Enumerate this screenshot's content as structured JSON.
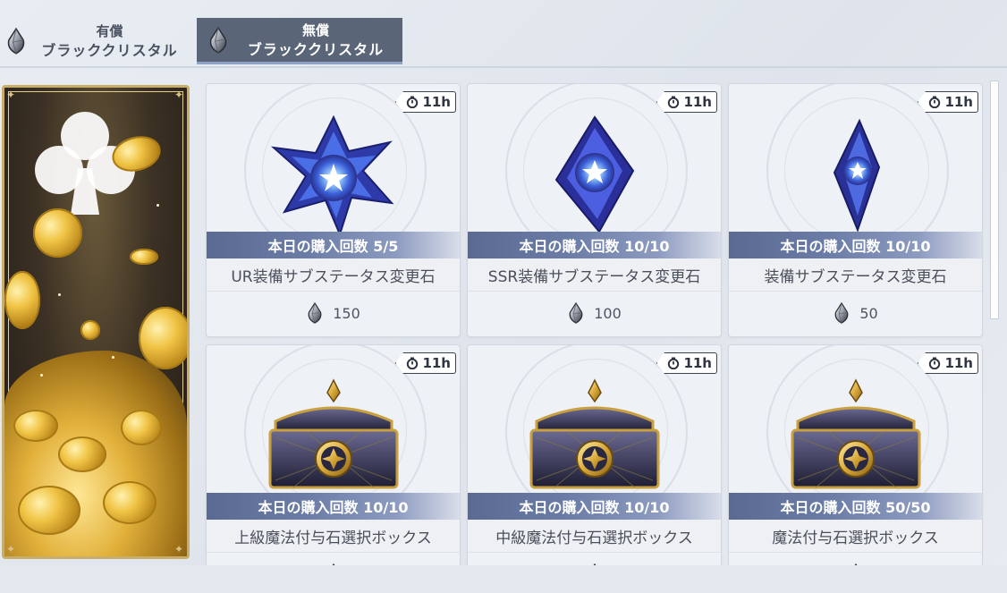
{
  "tabs": [
    {
      "line1": "有償",
      "line2": "ブラッククリスタル",
      "active": false,
      "icon": "black-crystal-icon"
    },
    {
      "line1": "無償",
      "line2": "ブラッククリスタル",
      "active": true,
      "icon": "black-crystal-icon"
    }
  ],
  "colors": {
    "active_tab": "#5a6677",
    "count_bar": "#6b7ca6",
    "banner_frame": "#c9ad6a"
  },
  "cards": [
    {
      "timer": "11h",
      "count": "本日の購入回数 5/5",
      "name": "UR装備サブステータス変更石",
      "price": "150",
      "art": "crystal-star-large"
    },
    {
      "timer": "11h",
      "count": "本日の購入回数 10/10",
      "name": "SSR装備サブステータス変更石",
      "price": "100",
      "art": "crystal-diamond"
    },
    {
      "timer": "11h",
      "count": "本日の購入回数 10/10",
      "name": "装備サブステータス変更石",
      "price": "50",
      "art": "crystal-shard"
    },
    {
      "timer": "11h",
      "count": "本日の購入回数 10/10",
      "name": "上級魔法付与石選択ボックス",
      "price": "",
      "art": "treasure-chest"
    },
    {
      "timer": "11h",
      "count": "本日の購入回数 10/10",
      "name": "中級魔法付与石選択ボックス",
      "price": "",
      "art": "treasure-chest"
    },
    {
      "timer": "11h",
      "count": "本日の購入回数 50/50",
      "name": "魔法付与石選択ボックス",
      "price": "",
      "art": "treasure-chest"
    }
  ]
}
